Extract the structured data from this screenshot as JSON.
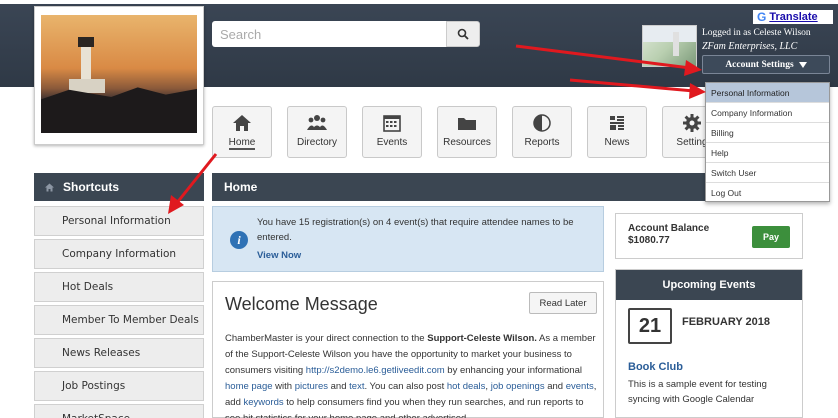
{
  "header": {
    "search_placeholder": "Search",
    "translate_label": "Translate",
    "logged_in_text": "Logged in as Celeste Wilson",
    "company": "ZFam Enterprises, LLC",
    "account_settings_label": "Account Settings"
  },
  "account_menu": {
    "items": [
      {
        "label": "Personal Information",
        "active": true
      },
      {
        "label": "Company Information",
        "active": false
      },
      {
        "label": "Billing",
        "active": false
      },
      {
        "label": "Help",
        "active": false
      },
      {
        "label": "Switch User",
        "active": false
      },
      {
        "label": "Log Out",
        "active": false
      }
    ]
  },
  "nav": {
    "items": [
      {
        "label": "Home",
        "icon": "home-icon"
      },
      {
        "label": "Directory",
        "icon": "people-icon"
      },
      {
        "label": "Events",
        "icon": "calendar-icon"
      },
      {
        "label": "Resources",
        "icon": "folder-icon"
      },
      {
        "label": "Reports",
        "icon": "pie-chart-icon"
      },
      {
        "label": "News",
        "icon": "news-icon"
      },
      {
        "label": "Setting",
        "icon": "gear-icon"
      }
    ]
  },
  "shortcuts": {
    "title": "Shortcuts",
    "items": [
      "Personal Information",
      "Company Information",
      "Hot Deals",
      "Member To Member Deals",
      "News Releases",
      "Job Postings",
      "MarketSpace"
    ]
  },
  "main": {
    "breadcrumb": "Home",
    "notice": {
      "message": "You have 15 registration(s) on 4 event(s) that require attendee names to be entered.",
      "link": "View Now"
    },
    "welcome": {
      "title": "Welcome Message",
      "read_later_label": "Read Later",
      "body_1": "ChamberMaster is your direct connection to the ",
      "body_bold": "Support-Celeste Wilson.",
      "body_2": " As a member of the Support-Celeste Wilson you have the opportunity to market your business to consumers visiting ",
      "link_site": "http://s2demo.le6.getliveedit.com",
      "body_3": " by enhancing your informational ",
      "link_home": "home page",
      "body_4": " with ",
      "link_pictures": "pictures",
      "body_5": " and ",
      "link_text": "text",
      "body_6": ". You can also post ",
      "link_hot": "hot deals",
      "body_7": ", ",
      "link_job": "job openings",
      "body_8": " and ",
      "link_events": "events",
      "body_9": ", add ",
      "link_keywords": "keywords",
      "body_10": " to help consumers find you when they run searches, and run reports to see hit statistics for your home page and other advertised"
    }
  },
  "balance": {
    "label": "Account Balance",
    "amount": "$1080.77",
    "pay_label": "Pay"
  },
  "upcoming": {
    "title": "Upcoming Events",
    "day": "21",
    "month": "FEBRUARY 2018",
    "event_title": "Book Club",
    "event_desc": "This is a sample event for testing syncing with Google Calendar"
  },
  "colors": {
    "header_bg": "#2f3946",
    "panel_dark": "#3b4652",
    "link": "#2a5d98",
    "pay_green": "#3c8f3c",
    "annotation_arrow": "#e0191f"
  }
}
